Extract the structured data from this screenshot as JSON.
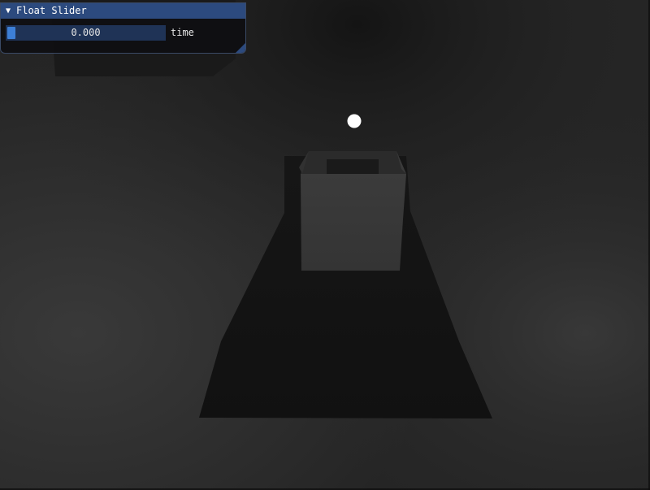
{
  "window": {
    "title": "Float Slider",
    "collapse_icon": "▼",
    "slider": {
      "value_text": "0.000",
      "value": 0.0,
      "label": "time"
    }
  },
  "colors": {
    "title_bar": "#2c4a7e",
    "slider_frame": "#1f3356",
    "slider_grab": "#3d7fd6",
    "window_bg": "#0f0f12",
    "scene_bg": "#2a2a2a"
  },
  "scene": {
    "light_icon": "light-sphere-icon"
  }
}
